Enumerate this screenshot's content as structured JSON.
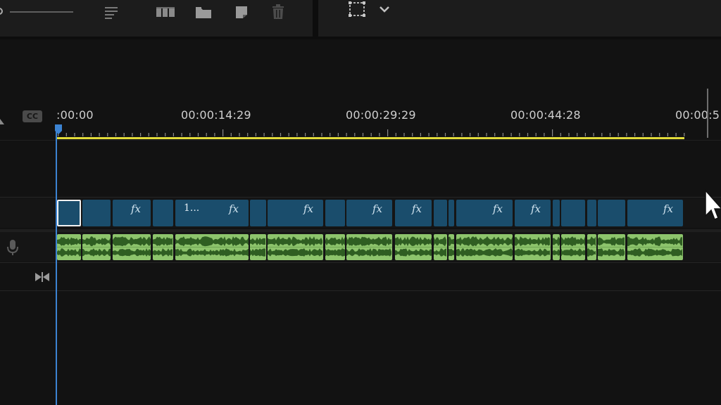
{
  "timeline": {
    "timecodes": [
      {
        "label": ":00:00"
      },
      {
        "label": "00:00:14:29"
      },
      {
        "label": "00:00:29:29"
      },
      {
        "label": "00:00:44:28"
      },
      {
        "label": "00:00:5"
      }
    ],
    "caption_badge": "CC"
  },
  "video_clips": [
    {
      "id": 1,
      "selected": true,
      "fx": false,
      "name": ""
    },
    {
      "id": 2,
      "fx": false,
      "name": ""
    },
    {
      "id": 3,
      "fx": true,
      "name": ""
    },
    {
      "id": 4,
      "fx": false,
      "name": ""
    },
    {
      "id": 5,
      "fx": true,
      "name": "1..."
    },
    {
      "id": 6,
      "fx": false,
      "name": ""
    },
    {
      "id": 7,
      "fx": true,
      "name": ""
    },
    {
      "id": 8,
      "fx": false,
      "name": ""
    },
    {
      "id": 9,
      "fx": true,
      "name": ""
    },
    {
      "id": 10,
      "fx": true,
      "name": ""
    },
    {
      "id": 11,
      "fx": false,
      "name": ""
    },
    {
      "id": 12,
      "fx": false,
      "name": ""
    },
    {
      "id": 13,
      "fx": true,
      "name": ""
    },
    {
      "id": 14,
      "fx": true,
      "name": ""
    },
    {
      "id": 15,
      "fx": false,
      "name": ""
    },
    {
      "id": 16,
      "fx": false,
      "name": ""
    },
    {
      "id": 17,
      "fx": false,
      "name": ""
    },
    {
      "id": 18,
      "fx": false,
      "name": ""
    },
    {
      "id": 19,
      "fx": true,
      "name": ""
    }
  ],
  "fx_label": "fx",
  "icons": {
    "zoom": "zoom-slider-icon",
    "list": "list-icon",
    "columns": "grid-view-icon",
    "folder": "folder-icon",
    "new_item": "new-item-icon",
    "trash": "trash-icon",
    "crop": "crop-frame-icon",
    "dropdown": "chevron-down-icon",
    "mic": "microphone-icon",
    "transition": "transition-icon",
    "cursor": "mouse-cursor-icon"
  },
  "colors": {
    "video_clip": "#1a4d6c",
    "audio_clip": "#8dc46c",
    "playhead": "#3c83d2",
    "work_area": "#e1db3a"
  }
}
